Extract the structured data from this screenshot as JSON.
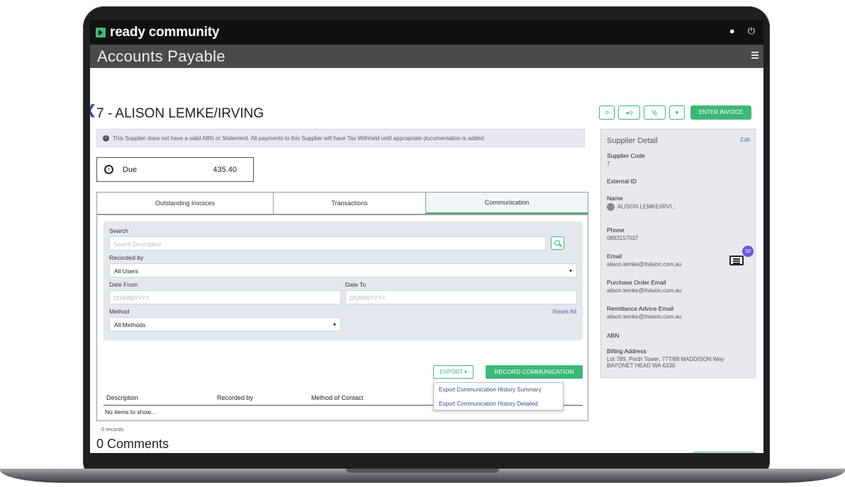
{
  "app": {
    "name": "ready community",
    "module_title": "Accounts Payable"
  },
  "header": {
    "supplier_title": "7 - ALISON LEMKE/IRVING"
  },
  "alert": {
    "text": "This Supplier does not have a valid ABN or Statement. All payments to this Supplier will have Tax Withheld until appropriate documentation is added."
  },
  "due": {
    "label": "Due",
    "amount": "435.40"
  },
  "tabs": [
    {
      "label": "Outstanding Invoices"
    },
    {
      "label": "Transactions"
    },
    {
      "label": "Communication",
      "active": true
    }
  ],
  "filters": {
    "search_label": "Search",
    "search_placeholder": "Search Description",
    "recorded_by_label": "Recorded by",
    "recorded_by_value": "All Users",
    "date_from_label": "Date From",
    "date_from_placeholder": "DD/MM/YYYY",
    "date_to_label": "Date To",
    "date_to_placeholder": "DD/MM/YYYY",
    "method_label": "Method",
    "method_value": "All Methods",
    "reset_label": "Reset All"
  },
  "toolbar": {
    "export_label": "EXPORT ▾",
    "record_label": "RECORD COMMUNICATION"
  },
  "export_menu": [
    {
      "label": "Export Communication History Summary"
    },
    {
      "label": "Export Communication History Detailed"
    }
  ],
  "table": {
    "columns": [
      "Description",
      "Recorded by",
      "Method of Contact"
    ],
    "empty_text": "No items to show...",
    "records_text": "0 records"
  },
  "comments": {
    "title": "0 Comments"
  },
  "actions": {
    "comment_count": "0",
    "enter_invoice_label": "ENTER INVOICE"
  },
  "supplier_detail": {
    "title": "Supplier Detail",
    "edit_label": "Edit",
    "supplier_code_label": "Supplier Code",
    "supplier_code": "7",
    "external_id_label": "External ID",
    "name_label": "Name",
    "name": "ALISON LEMKE/IRVI...",
    "phone_label": "Phone",
    "phone": "0893157037",
    "email_label": "Email",
    "email": "alison.lemke@itvision.com.au",
    "po_email_label": "Purchase Order Email",
    "po_email": "alison.lemke@itvision.com.au",
    "remit_email_label": "Remittance Advice Email",
    "remit_email": "alison.lemke@itvision.com.au",
    "abn_label": "ABN",
    "billing_label": "Billing Address",
    "billing_line1": "Lot 789, Perth Tower, 777/88 MADDISON Way",
    "billing_line2": "BAYONET HEAD WA 6330",
    "badge_count": "32"
  },
  "colors": {
    "accent": "#3cb878",
    "link": "#4a6fb0",
    "badge": "#6a5ad6"
  }
}
